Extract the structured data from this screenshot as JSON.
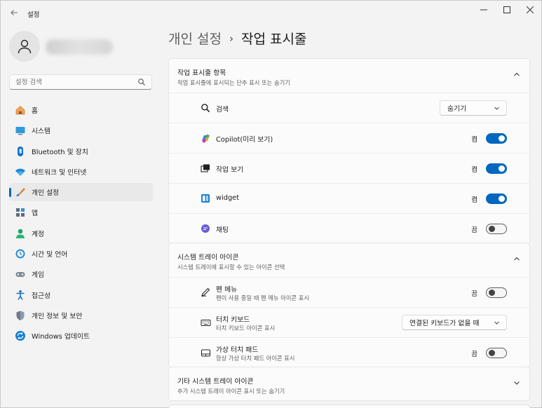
{
  "window": {
    "app_title": "설정",
    "back_icon": "back-arrow-icon",
    "controls": [
      "minimize-icon",
      "maximize-icon",
      "close-icon"
    ]
  },
  "sidebar": {
    "search_placeholder": "설정 검색",
    "items": [
      {
        "label": "홈",
        "icon": "home-icon",
        "active": false
      },
      {
        "label": "시스템",
        "icon": "system-icon",
        "active": false
      },
      {
        "label": "Bluetooth 및 장치",
        "icon": "bluetooth-icon",
        "active": false
      },
      {
        "label": "네트워크 및 인터넷",
        "icon": "network-icon",
        "active": false
      },
      {
        "label": "개인 설정",
        "icon": "personalization-icon",
        "active": true
      },
      {
        "label": "앱",
        "icon": "apps-icon",
        "active": false
      },
      {
        "label": "계정",
        "icon": "accounts-icon",
        "active": false
      },
      {
        "label": "시간 및 언어",
        "icon": "time-language-icon",
        "active": false
      },
      {
        "label": "게임",
        "icon": "gaming-icon",
        "active": false
      },
      {
        "label": "접근성",
        "icon": "accessibility-icon",
        "active": false
      },
      {
        "label": "개인 정보 및 보안",
        "icon": "privacy-shield-icon",
        "active": false
      },
      {
        "label": "Windows 업데이트",
        "icon": "windows-update-icon",
        "active": false
      }
    ]
  },
  "breadcrumb": {
    "parent": "개인 설정",
    "separator": "›",
    "current": "작업 표시줄"
  },
  "taskbar_items": {
    "title": "작업 표시줄 항목",
    "subtitle": "작업 표시줄에 표시되는 단추 표시 또는 숨기기",
    "rows": [
      {
        "label": "검색",
        "icon": "search-icon",
        "control": "select",
        "value": "숨기기"
      },
      {
        "label": "Copilot(미리 보기)",
        "icon": "copilot-icon",
        "control": "toggle",
        "state": "켬",
        "on": true
      },
      {
        "label": "작업 보기",
        "icon": "task-view-icon",
        "control": "toggle",
        "state": "켬",
        "on": true
      },
      {
        "label": "widget",
        "icon": "widgets-icon",
        "control": "toggle",
        "state": "켬",
        "on": true
      },
      {
        "label": "채팅",
        "icon": "chat-icon",
        "control": "toggle",
        "state": "끔",
        "on": false
      }
    ]
  },
  "system_tray": {
    "title": "시스템 트레이 아이콘",
    "subtitle": "시스템 트레이에 표시할 수 있는 아이콘 선택",
    "rows": [
      {
        "label": "펜 메뉴",
        "sub": "펜이 사용 중일 때 펜 메뉴 아이콘 표시",
        "icon": "pen-icon",
        "control": "toggle",
        "state": "끔",
        "on": false
      },
      {
        "label": "터치 키보드",
        "sub": "터치 키보드 아이콘 표시",
        "icon": "keyboard-icon",
        "control": "select",
        "value": "연결된 키보드가 없을 때"
      },
      {
        "label": "가상 터치 패드",
        "sub": "항상 가상 터치 패드 아이콘 표시",
        "icon": "touchpad-icon",
        "control": "toggle",
        "state": "끔",
        "on": false
      }
    ]
  },
  "other_tray": {
    "title": "기타 시스템 트레이 아이콘",
    "subtitle": "추가 시스템 트레이 아이콘 표시 또는 숨기기"
  },
  "colors": {
    "accent": "#0067c0",
    "background": "#f3f3f3",
    "card": "#fbfbfb"
  }
}
